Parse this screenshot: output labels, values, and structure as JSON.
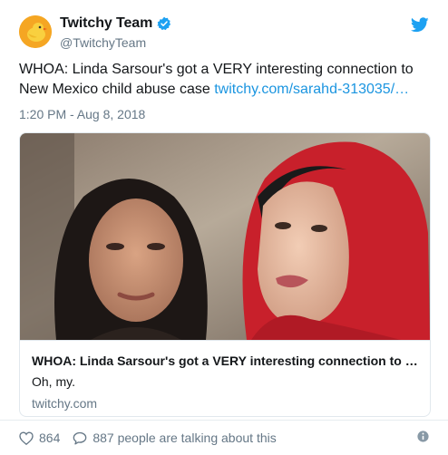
{
  "account": {
    "display_name": "Twitchy Team",
    "handle": "@TwitchyTeam",
    "verified": true,
    "avatar_icon": "orange-bird-avatar-icon",
    "brand_color": "#f5a623"
  },
  "tweet": {
    "text": "WHOA: Linda Sarsour's got a VERY interesting connection to New Mexico child abuse case ",
    "link_text": "twitchy.com/sarahd-313035/…",
    "timestamp": "1:20 PM - Aug 8, 2018",
    "link_color": "#1b95e0"
  },
  "card": {
    "title": "WHOA: Linda Sarsour's got a VERY interesting connection to …",
    "description": "Oh, my.",
    "domain": "twitchy.com"
  },
  "footer": {
    "likes": "864",
    "talking": "887 people are talking about this",
    "heart_icon": "heart-icon",
    "reply_icon": "speech-bubble-icon",
    "info_icon": "info-icon"
  },
  "logo": "twitter-bird-icon"
}
